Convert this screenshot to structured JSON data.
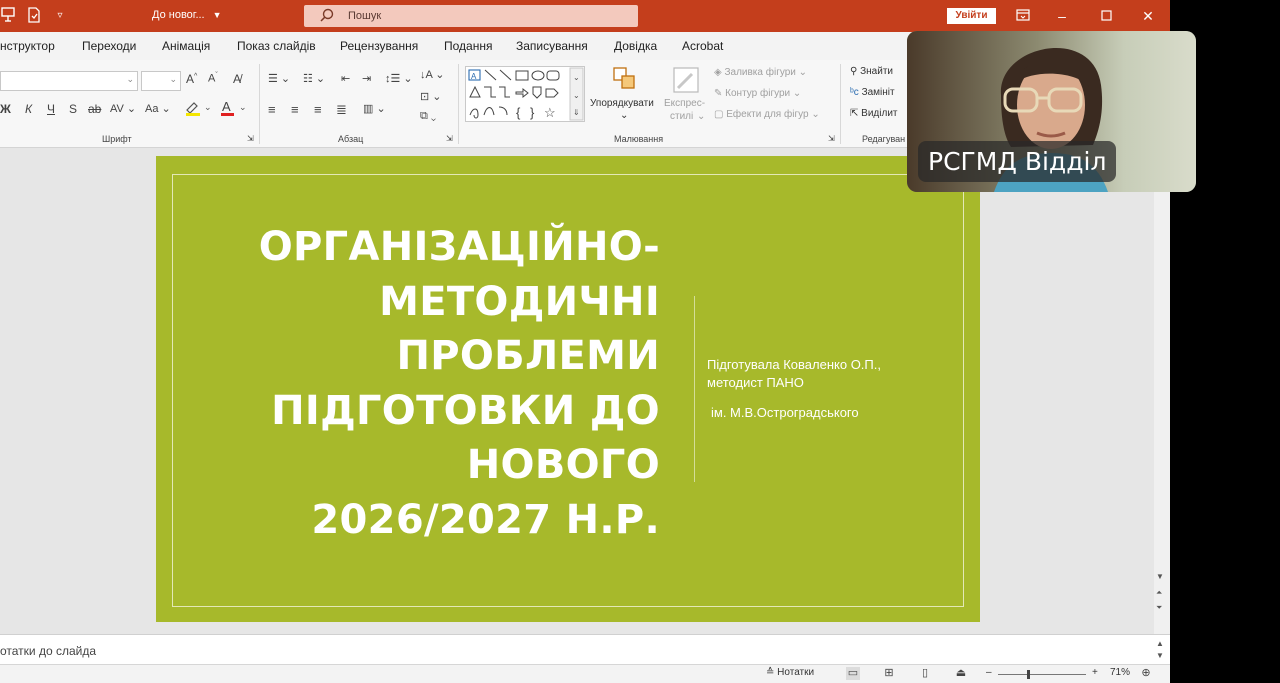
{
  "titlebar": {
    "doc_title": "До новог...",
    "search_placeholder": "Пошук",
    "signin_label": "Увійти",
    "accent_color": "#c43e1c"
  },
  "menu": {
    "tabs": [
      "нструктор",
      "Переходи",
      "Анімація",
      "Показ слайдів",
      "Рецензування",
      "Подання",
      "Записування",
      "Довідка",
      "Acrobat"
    ]
  },
  "ribbon": {
    "groups": {
      "font": "Шрифт",
      "paragraph": "Абзац",
      "drawing": "Малювання",
      "editing": "Редагуван"
    },
    "font_buttons": {
      "grow": "A",
      "shrink": "A",
      "bold": "Ж",
      "italic": "К",
      "underline": "Ч",
      "shadow": "S",
      "strike": "ab",
      "spacing": "AV",
      "case": "Aa"
    },
    "arrange_label": "Упорядкувати",
    "quick_styles_label_1": "Експрес-",
    "quick_styles_label_2": "стилі",
    "shape_fill": "Заливка фігури",
    "shape_outline": "Контур фігури",
    "shape_effects": "Ефекти для фігур",
    "find": "Знайти",
    "replace": "Замініт",
    "select": "Виділит"
  },
  "slide": {
    "title_lines": [
      "ОРГАНІЗАЦІЙНО-",
      "МЕТОДИЧНІ",
      "ПРОБЛЕМИ",
      "ПІДГОТОВКИ ДО",
      "НОВОГО",
      "2026/2027 Н.Р."
    ],
    "subtitle_line1": "Підготувала Коваленко О.П.,",
    "subtitle_line2": "методист ПАНО",
    "subtitle_line3": "ім. М.В.Остроградського",
    "bg_color": "#a7b92b"
  },
  "notes": {
    "placeholder": "отатки до слайда"
  },
  "status": {
    "notes_label": "Нотатки",
    "zoom": "71%",
    "zoom_minus": "–",
    "zoom_plus": "+"
  },
  "video": {
    "participant_name": "РСГМД Відділ"
  }
}
